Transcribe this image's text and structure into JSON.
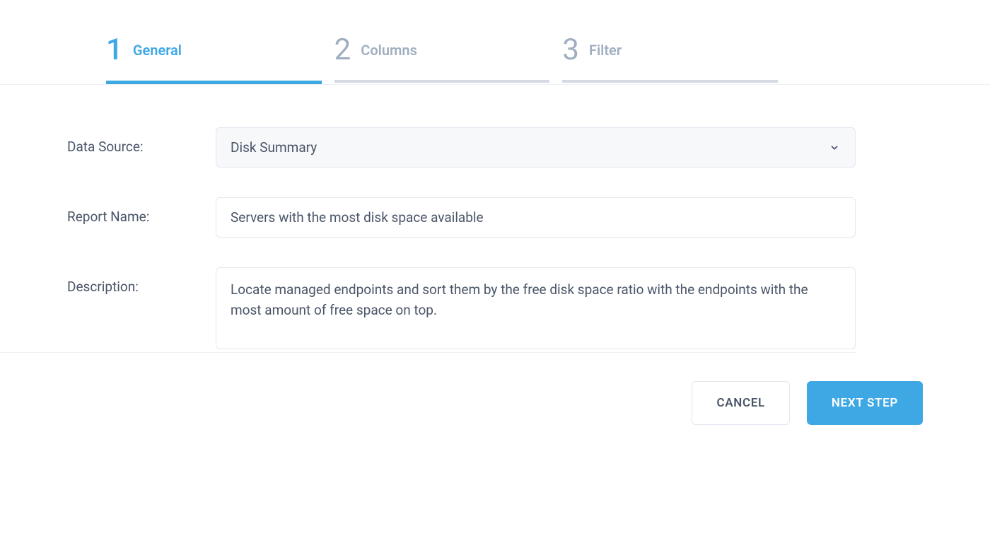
{
  "wizard": {
    "steps": [
      {
        "num": "1",
        "label": "General"
      },
      {
        "num": "2",
        "label": "Columns"
      },
      {
        "num": "3",
        "label": "Filter"
      }
    ],
    "active_index": 0
  },
  "form": {
    "data_source": {
      "label": "Data Source:",
      "value": "Disk Summary"
    },
    "report_name": {
      "label": "Report Name:",
      "value": "Servers with the most disk space available"
    },
    "description": {
      "label": "Description:",
      "value": "Locate managed endpoints and sort them by the free disk space ratio with the endpoints with the most amount of free space on top."
    }
  },
  "footer": {
    "cancel": "CANCEL",
    "next": "NEXT STEP"
  },
  "colors": {
    "accent": "#3ea8e5",
    "muted": "#a0aec0",
    "text": "#4a5568",
    "border": "#e2e7ef"
  }
}
